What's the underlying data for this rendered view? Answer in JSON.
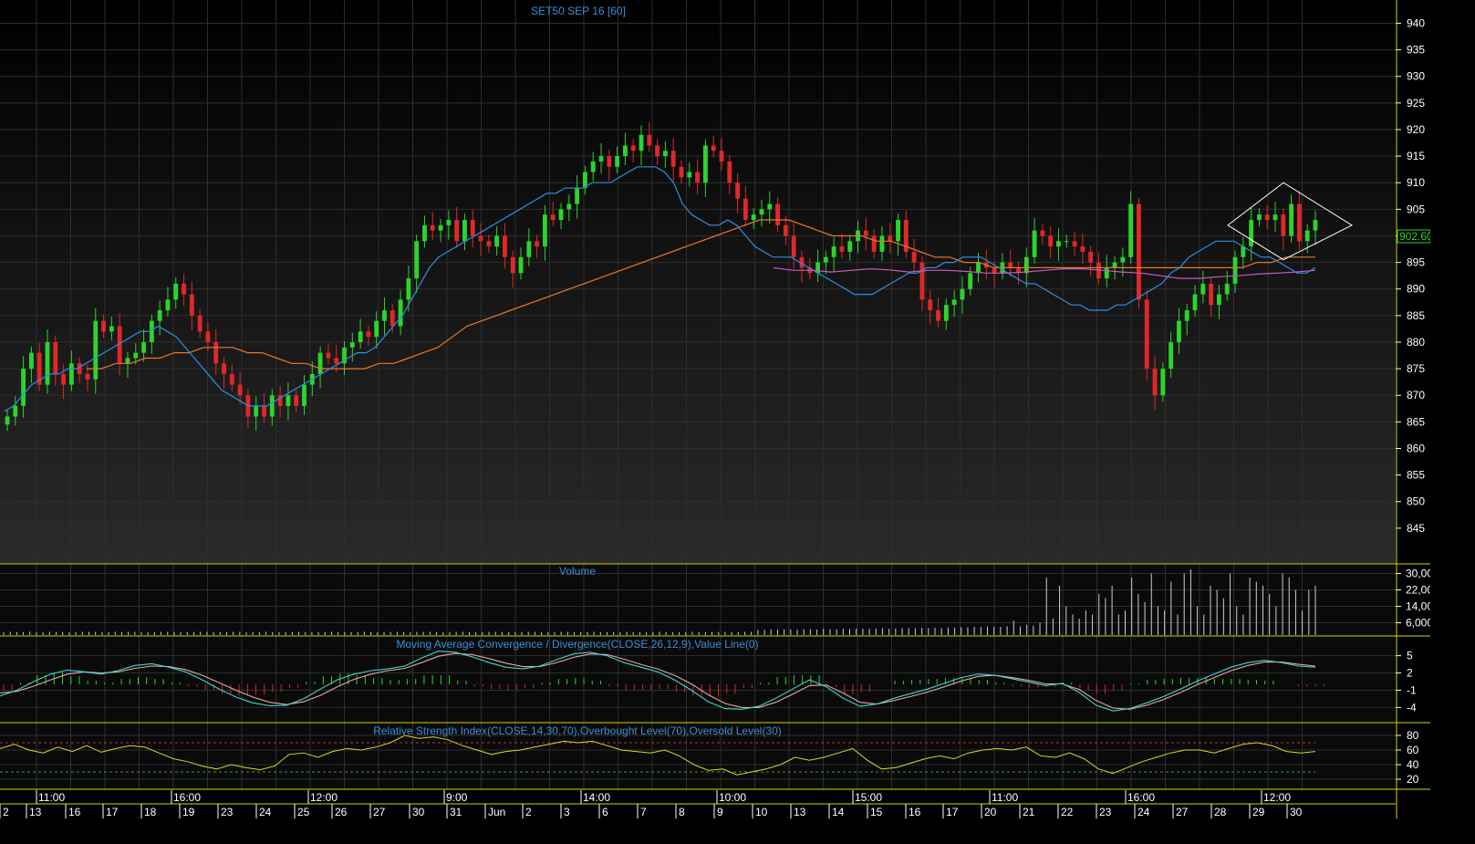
{
  "colors": {
    "background_top": "#000000",
    "background_bottom": "#2a2a2a",
    "frame": "#d6d600",
    "grid": "#2e2e2e",
    "title_text": "#3a8fd6",
    "axis_text": "#ffffff",
    "candle_up": "#2bd52b",
    "candle_down": "#e02828",
    "ma_fast": "#2f8de0",
    "ma_slow": "#e8772a",
    "ma_long": "#c35bc0",
    "macd_line": "#3fd6d6",
    "signal_line": "#e6a6a6",
    "rsi_line": "#d8d820",
    "last_price_box": "#2bd52b"
  },
  "chart_data": [
    {
      "panel": "price",
      "type": "candlestick",
      "title": "SET50 SEP 16  [60]",
      "ylim": [
        840,
        943
      ],
      "y_ticks": [
        940,
        935,
        930,
        925,
        920,
        915,
        910,
        905,
        900,
        895,
        890,
        885,
        880,
        875,
        870,
        865,
        860,
        855,
        850,
        845
      ],
      "last_price_label": "902.60",
      "grid": true,
      "close": [
        866,
        868,
        875,
        878,
        872,
        880,
        874,
        872,
        876,
        874,
        873,
        884,
        882,
        883,
        876,
        877,
        878,
        880,
        884,
        886,
        888,
        891,
        889,
        885,
        882,
        880,
        876,
        874,
        872,
        870,
        866,
        868,
        866,
        870,
        868,
        870,
        868,
        872,
        874,
        878,
        877,
        876,
        879,
        880,
        882,
        881,
        884,
        886,
        883,
        888,
        892,
        899,
        902,
        901,
        902,
        903,
        899,
        903,
        900,
        899,
        898,
        900,
        896,
        893,
        896,
        899,
        898,
        904,
        903,
        905,
        906,
        909,
        912,
        914,
        915,
        913,
        915,
        917,
        916,
        919,
        917,
        915,
        916,
        913,
        911,
        912,
        910,
        917,
        916,
        914,
        910,
        907,
        903,
        904,
        905,
        906,
        902,
        900,
        896,
        894,
        893,
        895,
        896,
        898,
        897,
        899,
        901,
        900,
        897,
        900,
        899,
        903,
        897,
        895,
        888,
        886,
        884,
        887,
        888,
        890,
        893,
        895,
        894,
        893,
        895,
        894,
        893,
        896,
        901,
        900,
        898,
        899,
        899,
        898,
        897,
        895,
        892,
        894,
        895,
        896,
        906,
        888,
        875,
        870,
        875,
        880,
        884,
        886,
        889,
        891,
        887,
        889,
        891,
        896,
        898,
        903,
        904,
        903,
        904,
        900,
        906,
        899,
        901,
        903
      ],
      "ma_fast": [
        867,
        868,
        870,
        872,
        873,
        874,
        874,
        875,
        875,
        876,
        877,
        878,
        879,
        880,
        881,
        882,
        882,
        883,
        882,
        881,
        879,
        877,
        875,
        873,
        871,
        870,
        869,
        868,
        868,
        868,
        869,
        870,
        871,
        872,
        873,
        874,
        875,
        876,
        877,
        878,
        878,
        879,
        881,
        883,
        885,
        888,
        891,
        894,
        896,
        897,
        898,
        899,
        900,
        901,
        902,
        903,
        904,
        905,
        906,
        907,
        908,
        908,
        909,
        909,
        909,
        910,
        910,
        910,
        911,
        912,
        913,
        913,
        913,
        912,
        910,
        906,
        904,
        903,
        902,
        902,
        903,
        902,
        900,
        898,
        897,
        896,
        896,
        896,
        895,
        894,
        893,
        892,
        891,
        890,
        889,
        889,
        889,
        890,
        891,
        892,
        893,
        893,
        894,
        894,
        895,
        895,
        896,
        896,
        896,
        895,
        894,
        893,
        892,
        891,
        891,
        890,
        889,
        888,
        887,
        887,
        886,
        886,
        886,
        887,
        887,
        888,
        889,
        890,
        891,
        893,
        894,
        896,
        897,
        898,
        899,
        899,
        899,
        898,
        897,
        896,
        896,
        895,
        894,
        893,
        893,
        894
      ],
      "ma_slow": [
        875,
        875,
        876,
        876,
        877,
        877,
        878,
        878,
        879,
        879,
        879,
        878,
        878,
        877,
        876,
        876,
        875,
        875,
        875,
        875,
        876,
        876,
        877,
        878,
        879,
        881,
        883,
        884,
        885,
        886,
        887,
        888,
        889,
        890,
        891,
        892,
        893,
        894,
        895,
        896,
        897,
        898,
        899,
        900,
        901,
        902,
        903,
        903,
        903,
        902,
        901,
        900,
        900,
        900,
        899,
        899,
        898,
        897,
        896,
        896,
        895,
        895,
        894,
        894,
        894,
        894,
        894,
        894,
        894,
        894,
        894,
        894,
        894,
        894,
        894,
        894,
        894,
        894,
        894,
        894,
        895,
        895,
        896,
        896,
        896
      ],
      "ma_long": [
        894,
        893.5,
        893.5,
        893.2,
        893.5,
        893.8,
        893.6,
        893.2,
        893.5,
        893.5,
        893.3,
        893.0,
        893.0,
        893.2,
        893.5,
        893.8,
        893.8,
        893.5,
        893.2,
        893.0,
        892.5,
        892.0,
        892.0,
        892.3,
        892.5,
        892.8,
        893.0,
        893.2,
        893.5
      ],
      "annotation": "diamond pattern"
    },
    {
      "panel": "volume",
      "type": "bar",
      "title": "Volume",
      "ylim": [
        0,
        32000
      ],
      "y_ticks": [
        "30,00",
        "22,00",
        "14,00",
        "6,000"
      ],
      "values": [
        1500,
        1600,
        1400,
        1500,
        1700,
        1500,
        1400,
        1600,
        1500,
        1500,
        1400,
        1500,
        1600,
        1500,
        1500,
        1400,
        1500,
        1600,
        1500,
        1500,
        1600,
        1500,
        1400,
        1500,
        1500,
        1600,
        1500,
        1400,
        1500,
        1500,
        1600,
        1500,
        1400,
        1500,
        1500,
        1600,
        1500,
        1400,
        1500,
        1500,
        1600,
        1500,
        1400,
        1500,
        1500,
        1600,
        1500,
        1400,
        1500,
        1500,
        1600,
        1500,
        1400,
        1500,
        1500,
        1600,
        1500,
        1400,
        1500,
        1500,
        1600,
        1500,
        1400,
        1500,
        1500,
        1600,
        1500,
        1400,
        1500,
        1500,
        1600,
        1500,
        1400,
        1500,
        1500,
        1600,
        1500,
        1400,
        1500,
        1500,
        1600,
        1500,
        1400,
        1500,
        1500,
        1600,
        1500,
        1400,
        1500,
        1500,
        1600,
        1500,
        1400,
        1500,
        1500,
        1600,
        1500,
        1400,
        1500,
        1500,
        1600,
        1500,
        1400,
        1500,
        1500,
        1600,
        1500,
        1400,
        1500,
        1500,
        1600,
        1500,
        1500,
        1600,
        1500,
        2500,
        2600,
        2700,
        2600,
        2800,
        2700,
        2600,
        2900,
        2800,
        2700,
        3000,
        2900,
        2800,
        3100,
        3000,
        3200,
        3100,
        3000,
        3200,
        3300,
        3100,
        3200,
        3300,
        3400,
        3300,
        3500,
        3400,
        3600,
        3500,
        3700,
        3600,
        3800,
        3700,
        4000,
        3900,
        4200,
        4100,
        4000,
        4300,
        7000,
        4200,
        5000,
        4500,
        6000,
        28000,
        8000,
        24000,
        14000,
        10000,
        8000,
        12000,
        10000,
        20000,
        18000,
        24000,
        10000,
        12000,
        28000,
        20000,
        16000,
        30000,
        14000,
        12000,
        26000,
        10000,
        30000,
        32000,
        14000,
        10000,
        24000,
        22000,
        18000,
        30000,
        14000,
        10000,
        28000,
        26000,
        24000,
        20000,
        14000,
        30000,
        28000,
        22000,
        12000,
        22000,
        24000
      ]
    },
    {
      "panel": "macd",
      "type": "line",
      "title": "Moving Average Convergence / Divergence(CLOSE,26,12,9),Value Line(0)",
      "ylim": [
        -6,
        7
      ],
      "y_ticks": [
        5,
        2,
        -1,
        -4
      ],
      "macd": [
        -2,
        -1,
        0.5,
        1.8,
        2.5,
        2.2,
        1.8,
        2.4,
        3.3,
        3.6,
        3.0,
        2.2,
        0.8,
        -0.8,
        -2.2,
        -3.2,
        -3.7,
        -3.6,
        -2.5,
        -0.8,
        0.8,
        1.8,
        2.4,
        2.7,
        3.2,
        4.6,
        5.8,
        5.6,
        4.8,
        3.8,
        3.0,
        2.7,
        3.2,
        4.3,
        5.3,
        5.6,
        5.0,
        3.8,
        3.0,
        2.2,
        0.8,
        -1.0,
        -3.0,
        -4.2,
        -4.3,
        -3.8,
        -2.4,
        -0.8,
        0.8,
        -0.4,
        -2.4,
        -3.8,
        -3.4,
        -2.4,
        -1.6,
        -0.8,
        0.2,
        1.2,
        1.8,
        1.6,
        1.0,
        0.4,
        -0.2,
        0.2,
        -1.4,
        -3.6,
        -4.6,
        -4.2,
        -3.2,
        -2.1,
        -0.8,
        0.6,
        1.8,
        3.0,
        3.8,
        4.2,
        3.8,
        3.2,
        3.0
      ],
      "signal": [
        -1.5,
        -1.2,
        -0.3,
        0.8,
        1.8,
        2.2,
        2.0,
        2.2,
        2.8,
        3.2,
        3.1,
        2.6,
        1.6,
        0.3,
        -1.0,
        -2.2,
        -3.1,
        -3.5,
        -3.0,
        -1.9,
        -0.4,
        0.9,
        1.8,
        2.4,
        2.8,
        3.8,
        4.9,
        5.4,
        5.2,
        4.5,
        3.7,
        3.1,
        3.1,
        3.8,
        4.7,
        5.3,
        5.2,
        4.4,
        3.5,
        2.7,
        1.6,
        0.1,
        -1.8,
        -3.3,
        -4.0,
        -4.0,
        -3.1,
        -1.7,
        -0.2,
        -0.1,
        -1.5,
        -3.1,
        -3.4,
        -2.8,
        -2.1,
        -1.3,
        -0.4,
        0.6,
        1.4,
        1.6,
        1.2,
        0.7,
        0.1,
        0.1,
        -0.9,
        -2.8,
        -4.1,
        -4.3,
        -3.6,
        -2.6,
        -1.4,
        0.0,
        1.2,
        2.4,
        3.3,
        3.9,
        3.9,
        3.5,
        3.2
      ],
      "histogram": [
        -0.6,
        0.2,
        1.0,
        1.3,
        0.9,
        0.4,
        0.2,
        0.6,
        0.8,
        0.6,
        0.2,
        -0.2,
        -0.6,
        -1.0,
        -1.2,
        -1.1,
        -0.8,
        -0.4,
        0.3,
        0.9,
        1.2,
        1.0,
        0.7,
        0.5,
        0.6,
        1.0,
        1.0,
        0.4,
        -0.2,
        -0.5,
        -0.6,
        -0.4,
        0.2,
        0.6,
        0.7,
        0.4,
        -0.2,
        -0.6,
        -0.6,
        -0.5,
        -0.8,
        -1.2,
        -1.3,
        -1.0,
        -0.4,
        0.2,
        0.8,
        1.0,
        1.0,
        -0.3,
        -1.0,
        -0.8,
        0.0,
        0.4,
        0.5,
        0.6,
        0.7,
        0.7,
        0.5,
        0.2,
        -0.2,
        -0.3,
        -0.3,
        0.2,
        -0.6,
        -1.0,
        -0.6,
        0.1,
        0.5,
        0.6,
        0.7,
        0.7,
        0.6,
        0.6,
        0.5,
        0.4,
        0.0,
        -0.2,
        -0.2
      ]
    },
    {
      "panel": "rsi",
      "type": "line",
      "title": "Relative Strength Index(CLOSE,14,30,70),Overbought Level(70),Oversold Level(30)",
      "ylim": [
        10,
        90
      ],
      "y_ticks": [
        80,
        60,
        40,
        20
      ],
      "overbought": 70,
      "oversold": 30,
      "values": [
        62,
        68,
        60,
        56,
        64,
        58,
        66,
        57,
        62,
        66,
        64,
        56,
        48,
        44,
        38,
        34,
        40,
        36,
        33,
        38,
        54,
        56,
        50,
        58,
        62,
        60,
        64,
        70,
        80,
        76,
        78,
        74,
        66,
        60,
        54,
        58,
        60,
        64,
        68,
        72,
        70,
        72,
        66,
        60,
        58,
        56,
        60,
        52,
        40,
        32,
        34,
        26,
        30,
        34,
        40,
        50,
        46,
        50,
        56,
        62,
        46,
        34,
        36,
        42,
        48,
        52,
        48,
        56,
        60,
        62,
        60,
        64,
        52,
        50,
        56,
        48,
        34,
        28,
        36,
        44,
        50,
        56,
        60,
        60,
        56,
        62,
        68,
        70,
        66,
        58,
        56,
        58
      ]
    }
  ],
  "time_axis": {
    "upper_labels": [
      "11:00",
      "16:00",
      "12:00",
      "9:00",
      "14:00",
      "10:00",
      "15:00",
      "11:00",
      "16:00",
      "12:00"
    ],
    "lower_labels": [
      "2",
      "13",
      "16",
      "17",
      "18",
      "19",
      "23",
      "24",
      "25",
      "26",
      "27",
      "30",
      "31",
      "Jun",
      "2",
      "3",
      "6",
      "7",
      "8",
      "9",
      "10",
      "13",
      "14",
      "15",
      "16",
      "17",
      "20",
      "21",
      "22",
      "23",
      "24",
      "27",
      "28",
      "29",
      "30"
    ]
  }
}
